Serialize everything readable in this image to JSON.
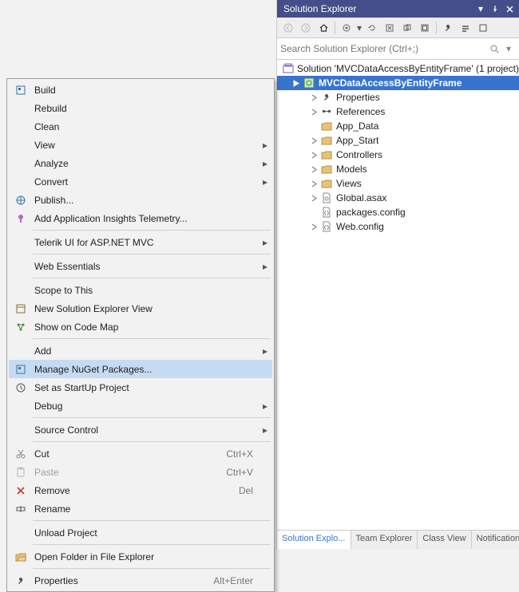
{
  "panel": {
    "title": "Solution Explorer",
    "search_placeholder": "Search Solution Explorer (Ctrl+;)",
    "solution_label": "Solution 'MVCDataAccessByEntityFrame' (1 project)",
    "project_label": "MVCDataAccessByEntityFrame",
    "nodes": {
      "properties": "Properties",
      "references": "References",
      "app_data": "App_Data",
      "app_start": "App_Start",
      "controllers": "Controllers",
      "models": "Models",
      "views": "Views",
      "global_asax": "Global.asax",
      "packages_config": "packages.config",
      "web_config": "Web.config"
    }
  },
  "bottom_tabs": {
    "solution_explorer": "Solution Explo...",
    "team_explorer": "Team Explorer",
    "class_view": "Class View",
    "notifications": "Notifications"
  },
  "menu": {
    "build": "Build",
    "rebuild": "Rebuild",
    "clean": "Clean",
    "view": "View",
    "analyze": "Analyze",
    "convert": "Convert",
    "publish": "Publish...",
    "add_app_insights": "Add Application Insights Telemetry...",
    "telerik": "Telerik UI for ASP.NET MVC",
    "web_essentials": "Web Essentials",
    "scope_to_this": "Scope to This",
    "new_solution_explorer_view": "New Solution Explorer View",
    "show_on_code_map": "Show on Code Map",
    "add": "Add",
    "manage_nuget": "Manage NuGet Packages...",
    "set_as_startup": "Set as StartUp Project",
    "debug": "Debug",
    "source_control": "Source Control",
    "cut": "Cut",
    "paste": "Paste",
    "remove": "Remove",
    "rename": "Rename",
    "unload_project": "Unload Project",
    "open_folder": "Open Folder in File Explorer",
    "properties": "Properties"
  },
  "shortcuts": {
    "cut": "Ctrl+X",
    "paste": "Ctrl+V",
    "remove": "Del",
    "properties": "Alt+Enter"
  }
}
